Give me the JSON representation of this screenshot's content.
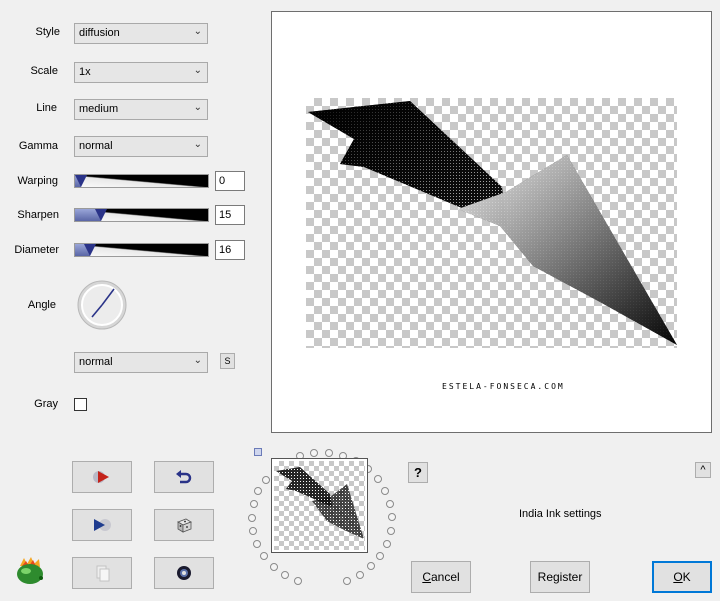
{
  "settings": {
    "style": {
      "label": "Style",
      "value": "diffusion"
    },
    "scale": {
      "label": "Scale",
      "value": "1x"
    },
    "line": {
      "label": "Line",
      "value": "medium"
    },
    "gamma": {
      "label": "Gamma",
      "value": "normal"
    },
    "warping": {
      "label": "Warping",
      "value": "0",
      "fraction": 0.0
    },
    "sharpen": {
      "label": "Sharpen",
      "value": "15",
      "fraction": 0.15
    },
    "diameter": {
      "label": "Diameter",
      "value": "16",
      "fraction": 0.07
    },
    "angle": {
      "label": "Angle"
    },
    "angle_mode": {
      "value": "normal",
      "s_button": "S"
    },
    "gray": {
      "label": "Gray",
      "checked": false
    }
  },
  "preview": {
    "watermark": "ESTELA-FONSECA.COM"
  },
  "help_button": "?",
  "collapse_button": "^",
  "status_text": "India Ink settings",
  "buttons": {
    "cancel": {
      "underline": "C",
      "rest": "ancel"
    },
    "register": "Register",
    "ok": {
      "underline": "O",
      "rest": "K"
    }
  },
  "icons": {
    "apply": "play-arrow-icon",
    "undo": "undo-icon",
    "random": "dice-icon",
    "copy": "copy-icon",
    "reset": "ring-icon",
    "logo": "flame-logo-icon"
  },
  "colors": {
    "accent": "#2a3388",
    "ok_border": "#0078d7"
  }
}
